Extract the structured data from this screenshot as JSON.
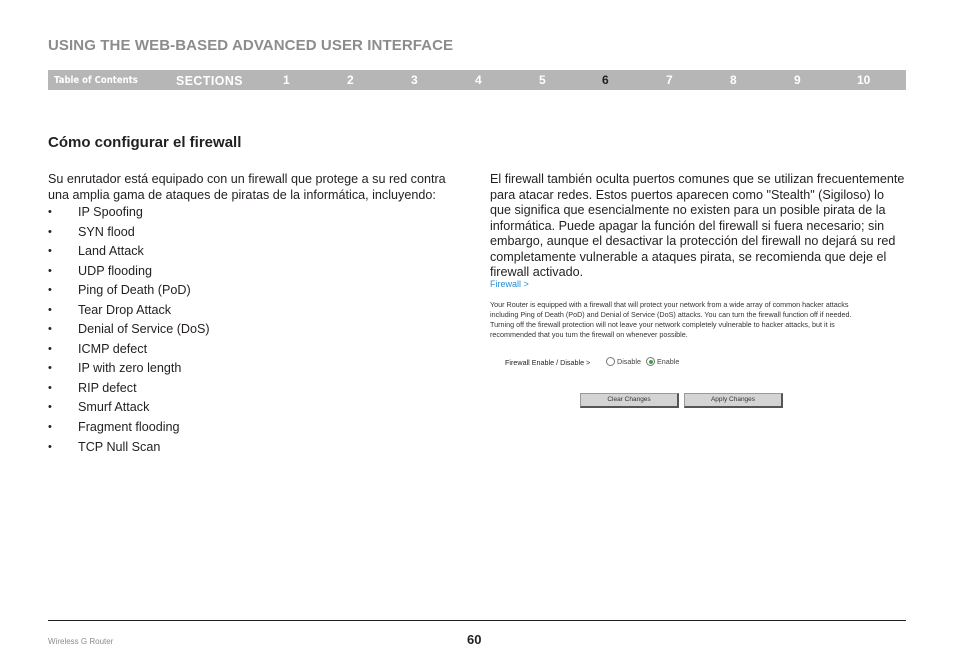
{
  "header": {
    "title": "USING THE WEB-BASED ADVANCED USER INTERFACE"
  },
  "nav": {
    "toc_label": "Table of Contents",
    "sections_label": "SECTIONS",
    "sections": [
      "1",
      "2",
      "3",
      "4",
      "5",
      "6",
      "7",
      "8",
      "9",
      "10"
    ],
    "active_section": "6"
  },
  "section": {
    "heading": "Cómo configurar el firewall",
    "intro": "Su enrutador está equipado con un firewall que protege a su red contra una amplia gama de ataques de piratas de la informática, incluyendo:",
    "bullet_glyph": "•",
    "attacks": [
      "IP Spoofing",
      "SYN flood",
      "Land Attack",
      "UDP flooding",
      "Ping of Death (PoD)",
      "Tear Drop Attack",
      "Denial of Service (DoS)",
      "ICMP defect",
      "IP with zero length",
      "RIP defect",
      "Smurf Attack",
      "Fragment flooding",
      "TCP Null Scan"
    ],
    "right_paragraph": "El firewall también oculta puertos comunes que se utilizan frecuentemente para atacar redes. Estos puertos aparecen como \"Stealth\" (Sigiloso) lo que significa que esencialmente no existen para un posible pirata de la informática. Puede apagar la función del firewall si fuera necesario; sin embargo, aunque el desactivar la protección del firewall no dejará su red completamente vulnerable a ataques pirata, se recomienda que deje el firewall activado."
  },
  "screenshot": {
    "link": "Firewall >",
    "description": "Your Router is equipped with a firewall that will protect your network from a wide array of common hacker attacks including Ping of Death (PoD) and Denial of Service (DoS) attacks. You can turn the firewall function off if needed. Turning off the firewall protection will not leave your network completely vulnerable to hacker attacks, but it is recommended that you turn the firewall on whenever possible.",
    "enable_label": "Firewall Enable / Disable >",
    "options": [
      {
        "label": "Disable",
        "checked": false
      },
      {
        "label": "Enable",
        "checked": true
      }
    ],
    "clear_button": "Clear Changes",
    "apply_button": "Apply Changes",
    "link_color": "#2a8fd6"
  },
  "footer": {
    "product": "Wireless G Router",
    "page_number": "60"
  }
}
